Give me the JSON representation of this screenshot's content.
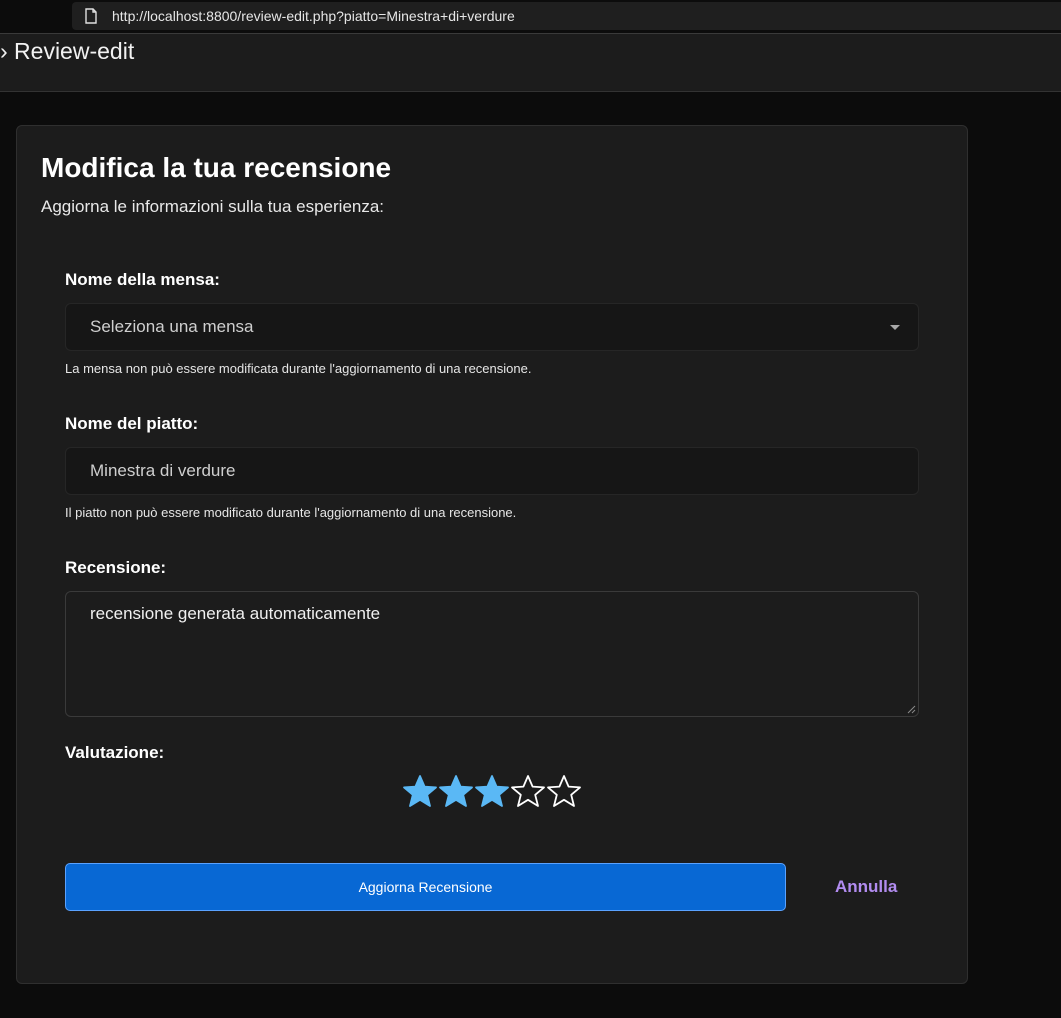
{
  "browser": {
    "url": "http://localhost:8800/review-edit.php?piatto=Minestra+di+verdure"
  },
  "breadcrumb": {
    "text": "› Review-edit"
  },
  "form": {
    "title": "Modifica la tua recensione",
    "subtitle": "Aggiorna le informazioni sulla tua esperienza:",
    "mensa_label": "Nome della mensa:",
    "mensa_placeholder": "Seleziona una mensa",
    "mensa_help": "La mensa non può essere modificata durante l'aggiornamento di una recensione.",
    "piatto_label": "Nome del piatto:",
    "piatto_value": "Minestra di verdure",
    "piatto_help": "Il piatto non può essere modificato durante l'aggiornamento di una recensione.",
    "recensione_label": "Recensione:",
    "recensione_value": "recensione generata automaticamente",
    "valutazione_label": "Valutazione:",
    "rating": 3,
    "rating_max": 5,
    "submit_label": "Aggiorna Recensione",
    "cancel_label": "Annulla"
  },
  "colors": {
    "accent": "#0868d4",
    "star_filled": "#5ab8f5",
    "link": "#b28cf0"
  },
  "icons": {
    "page": "page-icon",
    "star": "star-icon",
    "dropdown": "chevron-down-icon"
  }
}
